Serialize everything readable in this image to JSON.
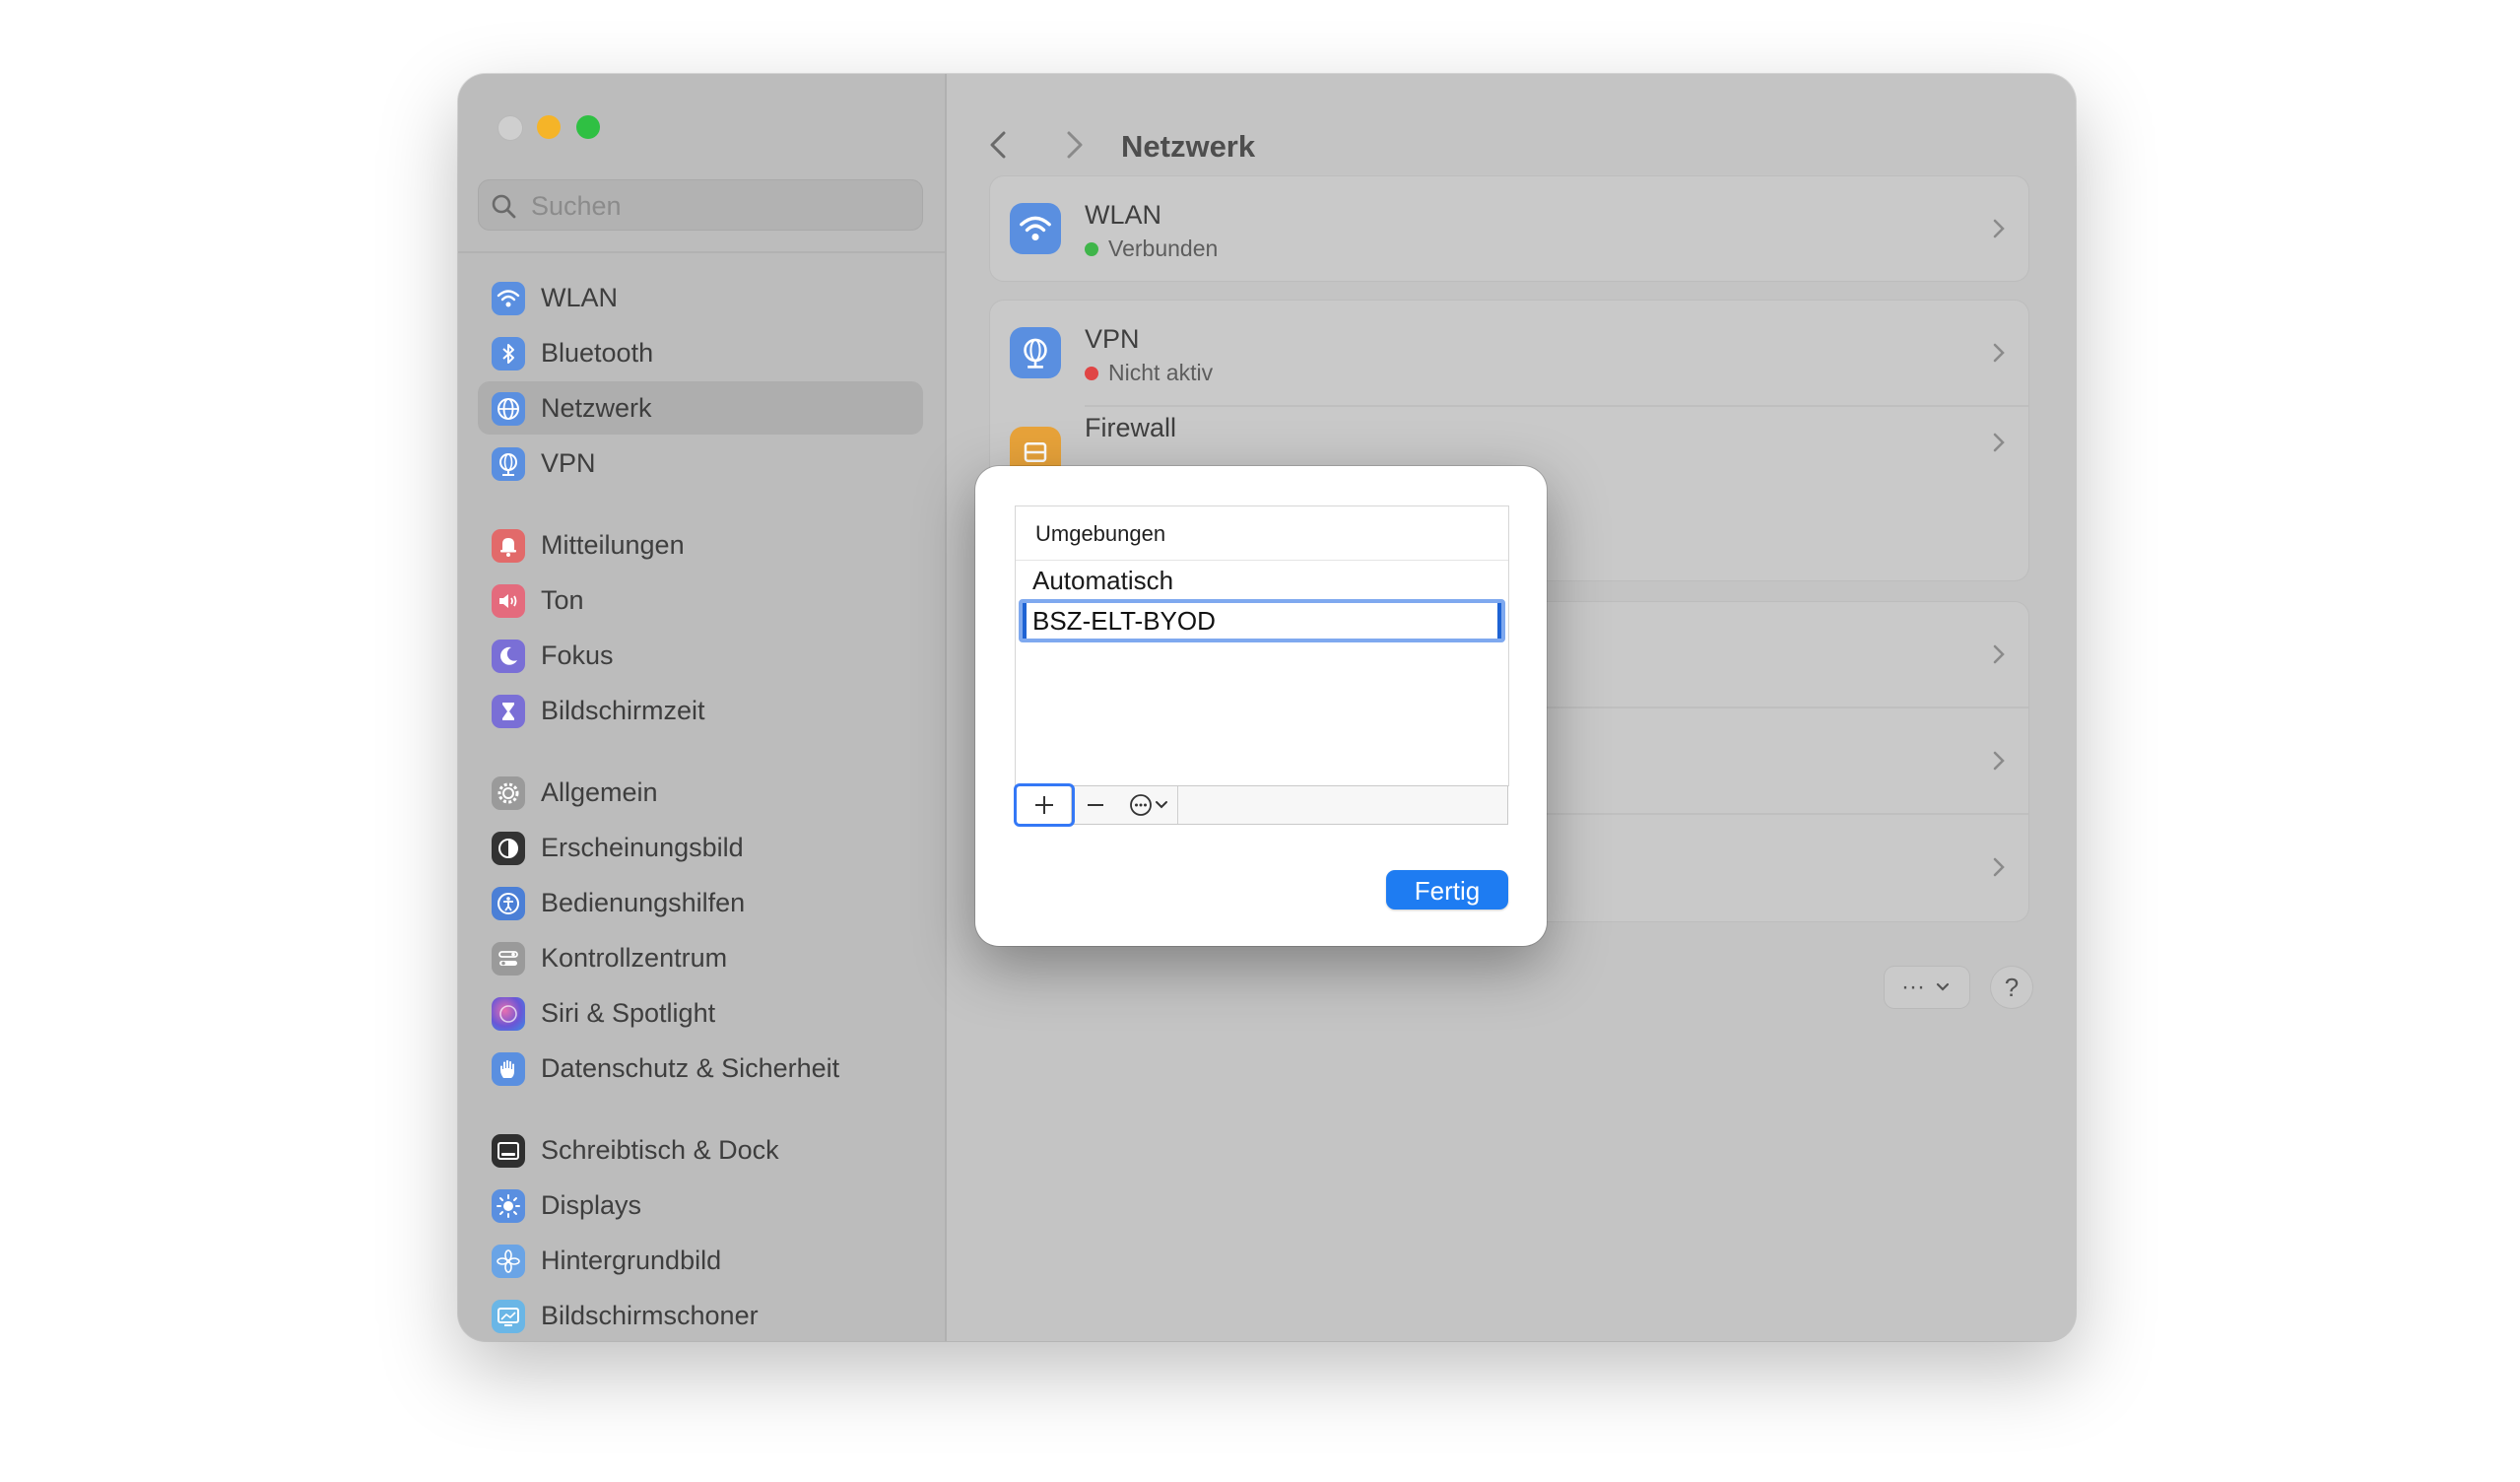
{
  "window": {
    "title": "Netzwerk"
  },
  "search": {
    "placeholder": "Suchen"
  },
  "sidebar": {
    "items": [
      {
        "label": "WLAN",
        "icon": "wifi-icon",
        "color": "#5a8fe0"
      },
      {
        "label": "Bluetooth",
        "icon": "bluetooth-icon",
        "color": "#5a8fe0"
      },
      {
        "label": "Netzwerk",
        "icon": "globe-icon",
        "color": "#5a8fe0"
      },
      {
        "label": "VPN",
        "icon": "vpn-globe-icon",
        "color": "#5a8fe0"
      },
      {
        "label": "Mitteilungen",
        "icon": "bell-icon",
        "color": "#e26a6a"
      },
      {
        "label": "Ton",
        "icon": "speaker-icon",
        "color": "#e46b7d"
      },
      {
        "label": "Fokus",
        "icon": "moon-icon",
        "color": "#7a6fd6"
      },
      {
        "label": "Bildschirmzeit",
        "icon": "hourglass-icon",
        "color": "#7a6fd6"
      },
      {
        "label": "Allgemein",
        "icon": "gear-icon",
        "color": "#9a9a9a"
      },
      {
        "label": "Erscheinungsbild",
        "icon": "appearance-icon",
        "color": "#333333"
      },
      {
        "label": "Bedienungshilfen",
        "icon": "accessibility-icon",
        "color": "#4b7fd6"
      },
      {
        "label": "Kontrollzentrum",
        "icon": "control-center-icon",
        "color": "#9a9a9a"
      },
      {
        "label": "Siri & Spotlight",
        "icon": "siri-icon",
        "color": "#8a5bd6"
      },
      {
        "label": "Datenschutz & Sicherheit",
        "icon": "hand-icon",
        "color": "#5a8fe0"
      },
      {
        "label": "Schreibtisch & Dock",
        "icon": "dock-icon",
        "color": "#2f2f2f"
      },
      {
        "label": "Displays",
        "icon": "sun-icon",
        "color": "#5a8fe0"
      },
      {
        "label": "Hintergrundbild",
        "icon": "flower-icon",
        "color": "#6aa4e6"
      },
      {
        "label": "Bildschirmschoner",
        "icon": "screensaver-icon",
        "color": "#6ab6e6"
      }
    ]
  },
  "main": {
    "rows": [
      {
        "title": "WLAN",
        "status": "Verbunden",
        "status_color": "#3fb54a",
        "icon": "wifi-icon"
      },
      {
        "title": "VPN",
        "status": "Nicht aktiv",
        "status_color": "#e04545",
        "icon": "vpn-globe-icon"
      },
      {
        "title": "Firewall",
        "status": "",
        "icon": "firewall-icon"
      }
    ],
    "more_button": "···",
    "help_button": "?"
  },
  "dialog": {
    "list_header": "Umgebungen",
    "rows": [
      "Automatisch"
    ],
    "edit_value": "BSZ-ELT-BYOD",
    "plus_label": "+",
    "minus_label": "—",
    "done_label": "Fertig",
    "accent": "#1e7cf2"
  }
}
